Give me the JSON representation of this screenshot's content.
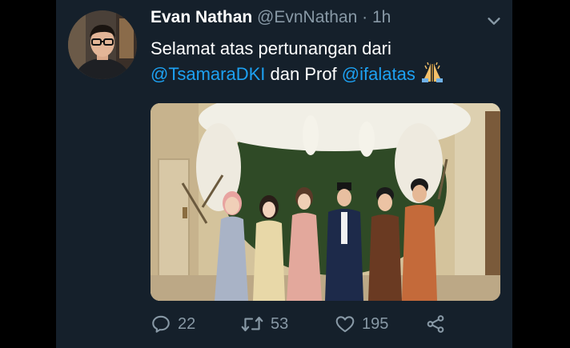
{
  "tweet": {
    "display_name": "Evan Nathan",
    "handle": "@EvnNathan",
    "separator": "·",
    "time": "1h",
    "text_line1": "Selamat atas pertunangan dari",
    "mention1": "@TsamaraDKI",
    "text_middle": "dan Prof",
    "mention2": "@ifalatas",
    "emoji": "folded-hands"
  },
  "actions": {
    "reply_count": "22",
    "retweet_count": "53",
    "like_count": "195"
  },
  "icons": [
    "chevron-down-icon",
    "reply-icon",
    "retweet-icon",
    "heart-icon",
    "share-icon",
    "folded-hands-emoji"
  ],
  "colors": {
    "background": "#15202b",
    "text": "#ffffff",
    "secondary": "#8899a6",
    "link": "#1da1f2"
  }
}
